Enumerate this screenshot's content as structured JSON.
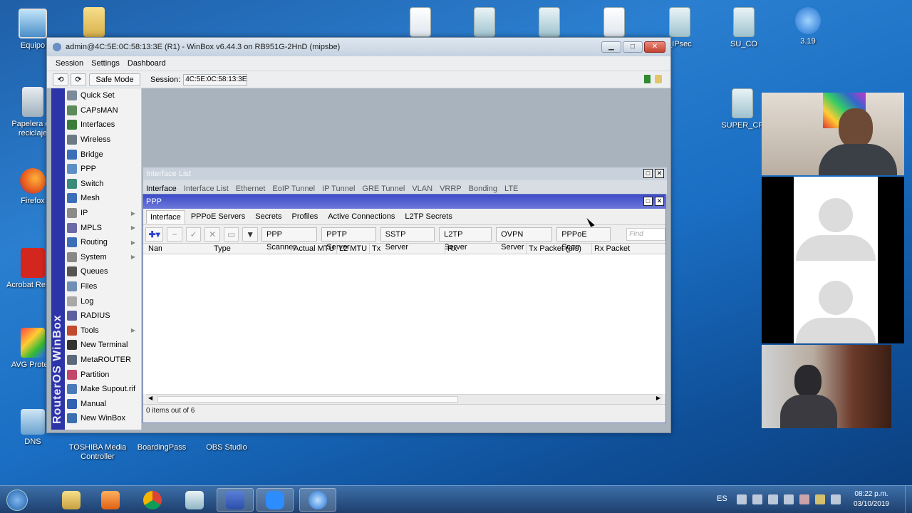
{
  "desktop": {
    "icons": [
      {
        "label": "Equipo"
      },
      {
        "label": "Papelera de reciclaje"
      },
      {
        "label": "Firefox"
      },
      {
        "label": "Acrobat Re DC"
      },
      {
        "label": "AVG Protect"
      },
      {
        "label": "DNS"
      },
      {
        "label": "TOSHIBA Media Controller"
      },
      {
        "label": "BoardingPass"
      },
      {
        "label": "OBS Studio"
      },
      {
        "label": "_IPsec"
      },
      {
        "label": "SU_CO"
      },
      {
        "label": "3.19"
      },
      {
        "label": "SUPER_CP"
      }
    ]
  },
  "winbox": {
    "title": "admin@4C:5E:0C:58:13:3E (R1) - WinBox v6.44.3 on RB951G-2HnD (mipsbe)",
    "menu": [
      "Session",
      "Settings",
      "Dashboard"
    ],
    "toolbar": {
      "safe_mode": "Safe Mode",
      "session_label": "Session:",
      "session_value": "4C:5E:0C:58:13:3E"
    },
    "brand": "RouterOS WinBox",
    "sidebar": [
      {
        "label": "Quick Set",
        "color": "#7a8a9a",
        "sub": false
      },
      {
        "label": "CAPsMAN",
        "color": "#5b8a5b",
        "sub": false
      },
      {
        "label": "Interfaces",
        "color": "#3a7d3a",
        "sub": false
      },
      {
        "label": "Wireless",
        "color": "#6d7a86",
        "sub": false
      },
      {
        "label": "Bridge",
        "color": "#3b6fb8",
        "sub": false
      },
      {
        "label": "PPP",
        "color": "#5d8fc7",
        "sub": false
      },
      {
        "label": "Switch",
        "color": "#3a8a7a",
        "sub": false
      },
      {
        "label": "Mesh",
        "color": "#3b6fb8",
        "sub": false
      },
      {
        "label": "IP",
        "color": "#8a8a8a",
        "sub": true
      },
      {
        "label": "MPLS",
        "color": "#6a6aa8",
        "sub": true
      },
      {
        "label": "Routing",
        "color": "#3b6fb8",
        "sub": true
      },
      {
        "label": "System",
        "color": "#888888",
        "sub": true
      },
      {
        "label": "Queues",
        "color": "#555555",
        "sub": false
      },
      {
        "label": "Files",
        "color": "#6f8fb4",
        "sub": false
      },
      {
        "label": "Log",
        "color": "#a8a8a8",
        "sub": false
      },
      {
        "label": "RADIUS",
        "color": "#5d5da0",
        "sub": false
      },
      {
        "label": "Tools",
        "color": "#c24a2e",
        "sub": true
      },
      {
        "label": "New Terminal",
        "color": "#333333",
        "sub": false
      },
      {
        "label": "MetaROUTER",
        "color": "#5b6a7a",
        "sub": false
      },
      {
        "label": "Partition",
        "color": "#c2456a",
        "sub": false
      },
      {
        "label": "Make Supout.rif",
        "color": "#4a7ab8",
        "sub": false
      },
      {
        "label": "Manual",
        "color": "#3060b0",
        "sub": false
      },
      {
        "label": "New WinBox",
        "color": "#3a6fb0",
        "sub": false
      }
    ],
    "interface_list": {
      "title": "Interface List",
      "tabs": [
        "Interface",
        "Interface List",
        "Ethernet",
        "EoIP Tunnel",
        "IP Tunnel",
        "GRE Tunnel",
        "VLAN",
        "VRRP",
        "Bonding",
        "LTE"
      ]
    },
    "ppp": {
      "title": "PPP",
      "tabs": [
        "Interface",
        "PPPoE Servers",
        "Secrets",
        "Profiles",
        "Active Connections",
        "L2TP Secrets"
      ],
      "active_tab": 0,
      "buttons": [
        "PPP Scanner",
        "PPTP Server",
        "SSTP Server",
        "L2TP Server",
        "OVPN Server",
        "PPPoE Scan"
      ],
      "find_placeholder": "Find",
      "columns": [
        "Name",
        "Type",
        "Actual MTU",
        "L2 MTU",
        "Tx",
        "Rx",
        "Tx Packet (p/s)",
        "Rx Packet"
      ],
      "rows": [],
      "status": "0 items out of 6"
    }
  },
  "taskbar": {
    "lang": "ES",
    "time": "08:22 p.m.",
    "date": "03/10/2019"
  },
  "colors": {
    "ppp_title": "#3d4bc9",
    "sidebar_brand": "#2d34a8",
    "desktop": "#1f5fa8"
  }
}
